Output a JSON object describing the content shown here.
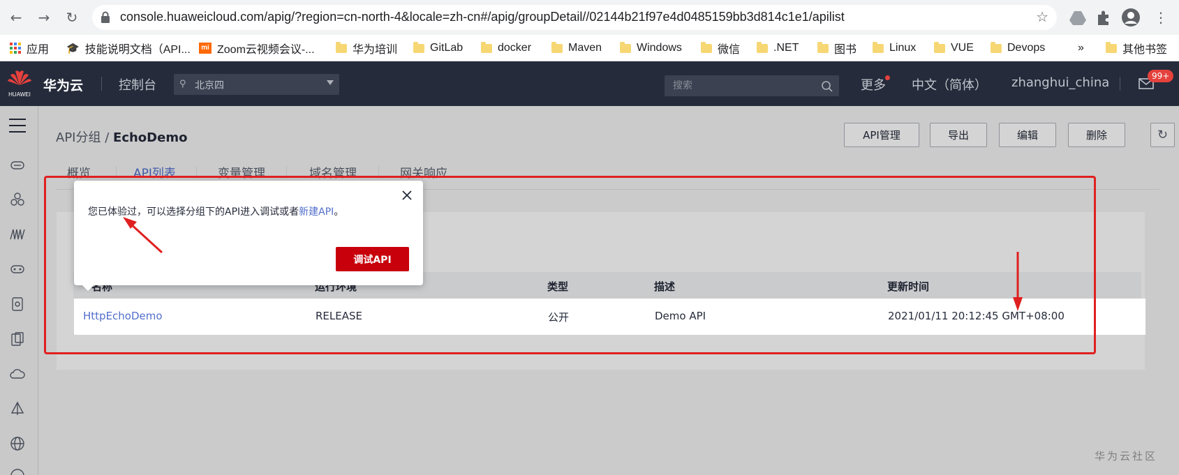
{
  "browser": {
    "url": "console.huaweicloud.com/apig/?region=cn-north-4&locale=zh-cn#/apig/groupDetail//02144b21f97e4d0485159bb3d814c1e1/apilist",
    "bookmarks": [
      {
        "label": "应用",
        "icon": "apps-grid-icon"
      },
      {
        "label": "技能说明文档（API...",
        "icon": "graduation-cap-icon"
      },
      {
        "label": "Zoom云视频会议-...",
        "icon": "mi-logo-icon"
      },
      {
        "label": "华为培训",
        "icon": "folder-icon"
      },
      {
        "label": "GitLab",
        "icon": "folder-icon"
      },
      {
        "label": "docker",
        "icon": "folder-icon"
      },
      {
        "label": "Maven",
        "icon": "folder-icon"
      },
      {
        "label": "Windows",
        "icon": "folder-icon"
      },
      {
        "label": "微信",
        "icon": "folder-icon"
      },
      {
        "label": ".NET",
        "icon": "folder-icon"
      },
      {
        "label": "图书",
        "icon": "folder-icon"
      },
      {
        "label": "Linux",
        "icon": "folder-icon"
      },
      {
        "label": "VUE",
        "icon": "folder-icon"
      },
      {
        "label": "Devops",
        "icon": "folder-icon"
      }
    ],
    "more_bookmarks": "»",
    "other_bookmarks": "其他书签"
  },
  "header": {
    "logo_text": "HUAWEI",
    "brand": "华为云",
    "console": "控制台",
    "region": "北京四",
    "search_placeholder": "搜索",
    "more": "更多",
    "language": "中文（简体）",
    "username": "zhanghui_china",
    "mail_badge": "99+"
  },
  "page": {
    "breadcrumb_parent": "API分组",
    "breadcrumb_sep": "/",
    "breadcrumb_current": "EchoDemo",
    "buttons": {
      "api_manage": "API管理",
      "export": "导出",
      "edit": "编辑",
      "delete": "删除"
    },
    "tabs": [
      "概览",
      "API列表",
      "变量管理",
      "域名管理",
      "网关响应"
    ],
    "active_tab": "API列表"
  },
  "table": {
    "columns": [
      "名称",
      "运行环境",
      "类型",
      "描述",
      "更新时间"
    ],
    "rows": [
      {
        "name": "HttpEchoDemo",
        "env": "RELEASE",
        "type": "公开",
        "desc": "Demo API",
        "updated": "2021/01/11 20:12:45 GMT+08:00"
      }
    ]
  },
  "popup": {
    "text": "您已体验过，可以选择分组下的API进入调试或者",
    "link": "新建API",
    "end": "。",
    "button": "调试API"
  },
  "watermark": "华为云社区",
  "colors": {
    "header_bg": "#252b3a",
    "primary_red": "#c7000b",
    "link_blue": "#526ecc",
    "annotation_red": "#e02020"
  }
}
